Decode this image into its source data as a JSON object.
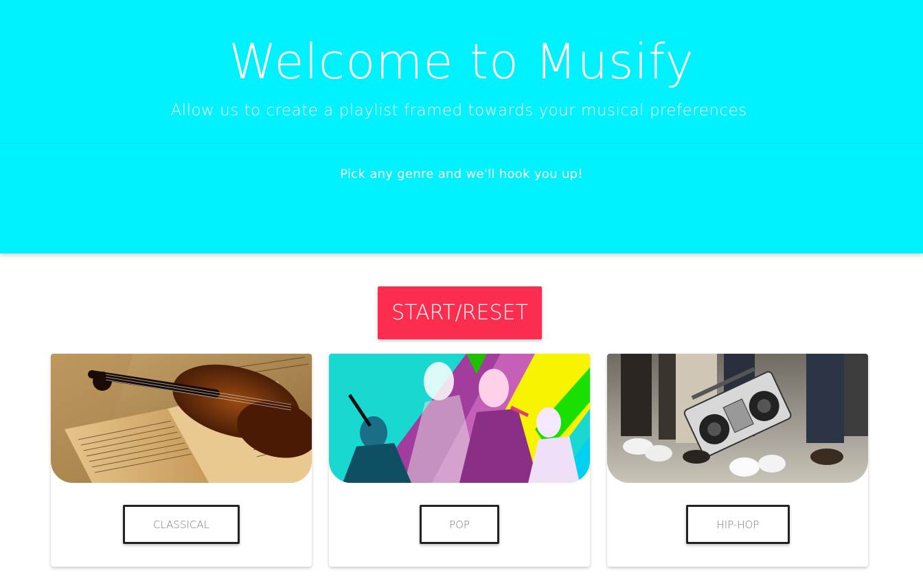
{
  "hero": {
    "title": "Welcome to Musify",
    "subtitle": "Allow us to create a playlist framed towards your musical preferences.",
    "tagline": "Pick any genre and we'll hook you up!",
    "background_color": "#00f2ff"
  },
  "controls": {
    "start_reset_label": "START/RESET",
    "accent_color": "#fc2d4e"
  },
  "genres": [
    {
      "label": "CLASSICAL",
      "image": "violin-sheet-music-image"
    },
    {
      "label": "POP",
      "image": "pop-artists-collage-image"
    },
    {
      "label": "HIP-HOP",
      "image": "boombox-sneakers-image"
    }
  ]
}
